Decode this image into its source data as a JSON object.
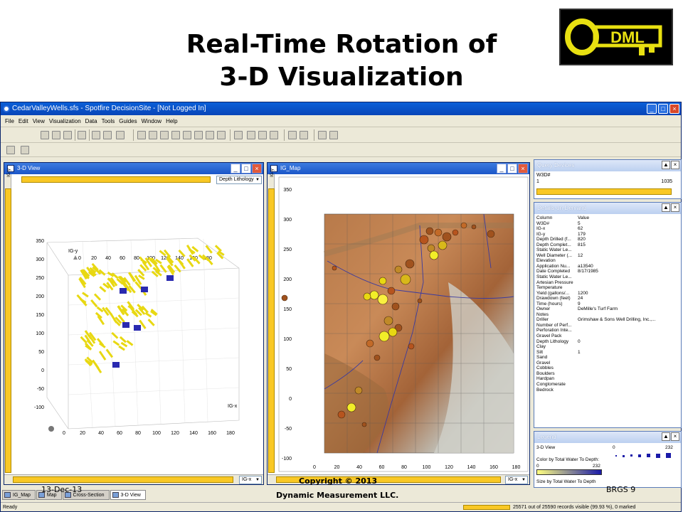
{
  "slide": {
    "title_line1": "Real-Time Rotation of",
    "title_line2": "3-D Visualization",
    "logo_text": "DML",
    "footer_date": "13-Dec-13",
    "footer_copyright_line1": "Copyright © 2013",
    "footer_copyright_line2": "Dynamic Measurement LLC.",
    "footer_page": "BRGS  9"
  },
  "window": {
    "title": "CedarValleyWells.sfs - Spotfire DecisionSite - [Not Logged In]",
    "menu": [
      "File",
      "Edit",
      "View",
      "Visualization",
      "Data",
      "Tools",
      "Guides",
      "Window",
      "Help"
    ]
  },
  "view3d": {
    "title": "3-D View",
    "dropdown": "Depth Lithology",
    "axis_y_label": "IG-y",
    "axis_x_label": "IG-x",
    "axis_z_ticks": [
      "350",
      "300",
      "250",
      "200",
      "150",
      "100",
      "50",
      "0",
      "-50",
      "-100"
    ],
    "top_x_ticks": [
      "0",
      "20",
      "40",
      "60",
      "80",
      "100",
      "120",
      "140",
      "160",
      "180"
    ],
    "bottom_x_ticks": [
      "0",
      "20",
      "40",
      "60",
      "80",
      "100",
      "120",
      "140",
      "160",
      "180"
    ],
    "x_axis_selector": "IG-x",
    "y_axis_selector": "IG-y"
  },
  "map": {
    "title": "IG_Map",
    "y_axis_selector": "IG-y",
    "x_axis_selector": "IG-x",
    "y_ticks": [
      "350",
      "300",
      "250",
      "200",
      "150",
      "100",
      "50",
      "0",
      "-50",
      "-100"
    ],
    "x_ticks": [
      "0",
      "20",
      "40",
      "60",
      "80",
      "100",
      "120",
      "140",
      "160",
      "180"
    ]
  },
  "query_devices": {
    "title": "Query Devices",
    "field": "W3D#",
    "min": "1",
    "max": "1035"
  },
  "details": {
    "title": "Details-on-Demand",
    "header": [
      "Column",
      "Value"
    ],
    "rows": [
      [
        "W3D#",
        "5"
      ],
      [
        "IG-x",
        "62"
      ],
      [
        "IG-y",
        "179"
      ],
      [
        "Depth Drilled (f...",
        "820"
      ],
      [
        "Depth Complet...",
        "815"
      ],
      [
        "Static Water Le...",
        ""
      ],
      [
        "Well Diameter (...",
        "12"
      ],
      [
        "Elevation",
        ""
      ],
      [
        "Application Nu...",
        "a13540"
      ],
      [
        "Date Completed",
        "8/17/1985"
      ],
      [
        "Static Water Le...",
        ""
      ],
      [
        "Artesian Pressure",
        ""
      ],
      [
        "Temperature",
        ""
      ],
      [
        "Yield (gallons/...",
        "1200"
      ],
      [
        "Drawdown (feet)",
        "24"
      ],
      [
        "Time (hours)",
        "9"
      ],
      [
        "Owner",
        "DeMille's Turf Farm"
      ],
      [
        "Notes",
        ""
      ],
      [
        "Driller",
        "Grimshaw & Sons Well Drilling, Inc.,..."
      ],
      [
        "Number of Perf...",
        ""
      ],
      [
        "Perforation Inte...",
        ""
      ],
      [
        "Gravel Pack",
        ""
      ],
      [
        "Depth Lithology",
        "0"
      ],
      [
        "Clay",
        ""
      ],
      [
        "Silt",
        "1"
      ],
      [
        "Sand",
        ""
      ],
      [
        "Gravel",
        ""
      ],
      [
        "Cobbles",
        ""
      ],
      [
        "Boulders",
        ""
      ],
      [
        "Hardpan",
        ""
      ],
      [
        "Conglomerate",
        ""
      ],
      [
        "Bedrock",
        ""
      ]
    ]
  },
  "legend": {
    "title": "Legend",
    "view": "3-D View",
    "color_label": "Color by Total Water To Depth:",
    "color_min": "0",
    "color_max": "232",
    "size_label": "Size by Total Water To Depth",
    "size_min": "0",
    "size_max": "232"
  },
  "tabs": [
    "IG_Map",
    "Map",
    "Cross-Section",
    "3-D View"
  ],
  "status": {
    "left": "Ready",
    "right": "25571 out of 25590 records visible (99.93 %), 0 marked"
  },
  "colors": {
    "accent_yellow": "#f9c825",
    "title_blue": "#1b56c8",
    "marker_brown": "#a0521e"
  }
}
